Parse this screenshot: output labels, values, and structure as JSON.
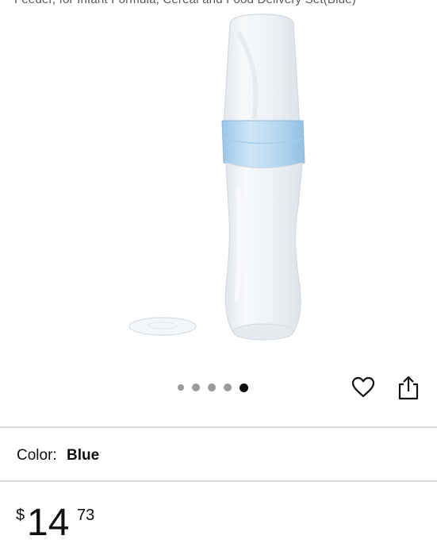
{
  "header": {
    "title_snippet": "Feeder, for Infant Formula, Cereal and Food Delivery Set(Blue)"
  },
  "gallery": {
    "image_alt": "Baby bottle squeeze feeder with blue ring and clear lid",
    "dot_count": 5,
    "active_index": 4
  },
  "actions": {
    "favorite_icon": "heart-icon",
    "share_icon": "share-icon"
  },
  "variation": {
    "label": "Color:",
    "value": "Blue"
  },
  "price": {
    "symbol": "$",
    "whole": "14",
    "fraction": "73"
  },
  "colors": {
    "accent_blue": "#aacdea",
    "divider": "#d5d9d9",
    "active_dot": "#111111",
    "inactive_dot": "#9a9a9a"
  }
}
